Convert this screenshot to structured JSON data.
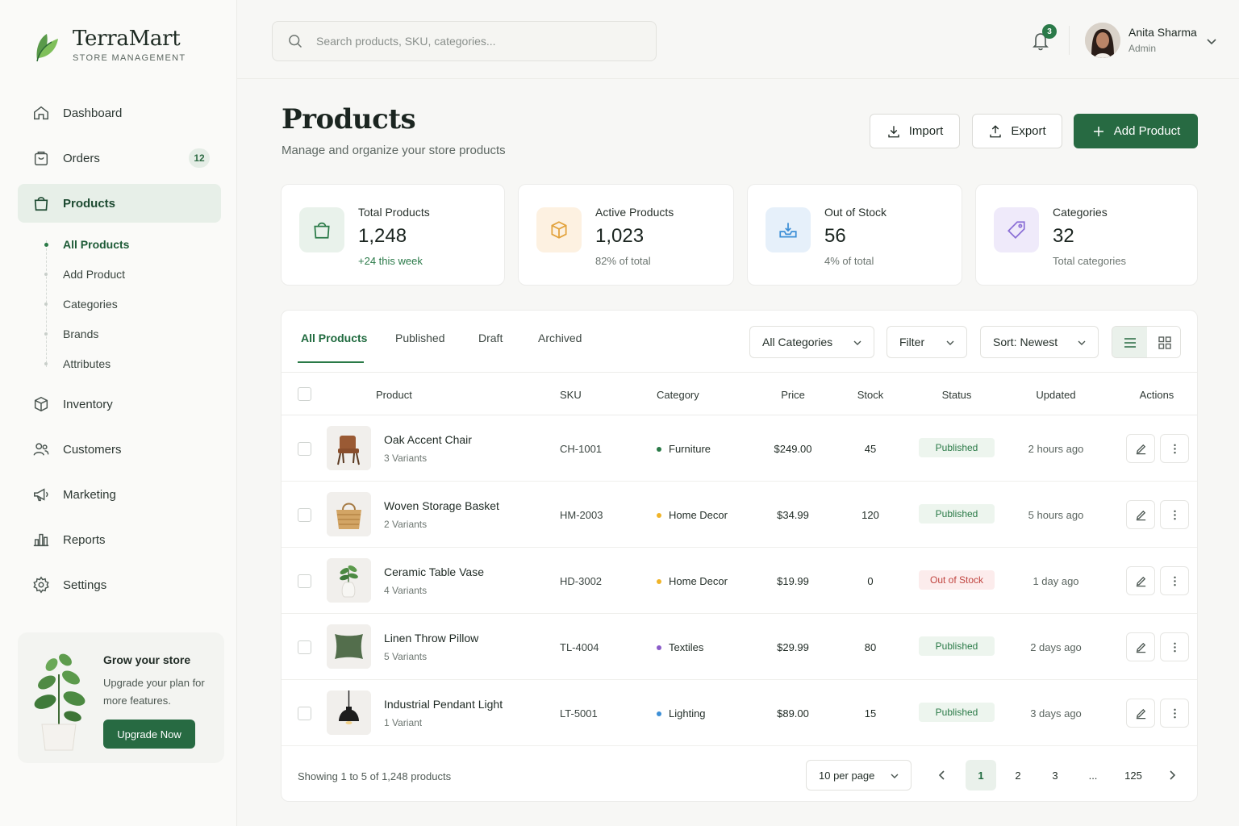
{
  "brand": {
    "name": "TerraMart",
    "subtitle": "STORE MANAGEMENT"
  },
  "sidebar": {
    "items": [
      {
        "label": "Dashboard",
        "icon": "home-icon"
      },
      {
        "label": "Orders",
        "icon": "bag-icon",
        "badge": "12"
      },
      {
        "label": "Products",
        "icon": "shopping-bag-icon",
        "active": true
      },
      {
        "label": "Inventory",
        "icon": "box-icon"
      },
      {
        "label": "Customers",
        "icon": "users-icon"
      },
      {
        "label": "Marketing",
        "icon": "megaphone-icon"
      },
      {
        "label": "Reports",
        "icon": "bar-chart-icon"
      },
      {
        "label": "Settings",
        "icon": "gear-icon"
      }
    ],
    "subitems": [
      {
        "label": "All Products",
        "active": true
      },
      {
        "label": "Add Product"
      },
      {
        "label": "Categories"
      },
      {
        "label": "Brands"
      },
      {
        "label": "Attributes"
      }
    ],
    "promo": {
      "title": "Grow your store",
      "text": "Upgrade your plan for more features.",
      "button": "Upgrade Now"
    }
  },
  "header": {
    "search_placeholder": "Search products, SKU, categories...",
    "notifications": "3",
    "user": {
      "name": "Anita Sharma",
      "role": "Admin"
    }
  },
  "page": {
    "title": "Products",
    "subtitle": "Manage and organize your store products",
    "actions": {
      "import": "Import",
      "export": "Export",
      "add": "Add Product"
    }
  },
  "stats": [
    {
      "label": "Total Products",
      "value": "1,248",
      "note": "+24 this week",
      "icon": "shopping-bag-icon",
      "color": "#e9f2eb"
    },
    {
      "label": "Active Products",
      "value": "1,023",
      "note": "82% of total",
      "icon": "cube-icon",
      "color": "#fdf1e1"
    },
    {
      "label": "Out of Stock",
      "value": "56",
      "note": "4% of total",
      "icon": "empty-box-icon",
      "color": "#e6f0fa"
    },
    {
      "label": "Categories",
      "value": "32",
      "note": "Total categories",
      "icon": "tag-icon",
      "color": "#efeafa"
    }
  ],
  "table": {
    "tabs": [
      "All Products",
      "Published",
      "Draft",
      "Archived"
    ],
    "filters": {
      "category": "All Categories",
      "filter": "Filter",
      "sort": "Sort: Newest"
    },
    "columns": [
      "Product",
      "SKU",
      "Category",
      "Price",
      "Stock",
      "Status",
      "Updated",
      "Actions"
    ],
    "rows": [
      {
        "name": "Oak Accent Chair",
        "variants": "3 Variants",
        "sku": "CH-1001",
        "category": "Furniture",
        "cat_color": "#2a7a47",
        "price": "$249.00",
        "stock": "45",
        "status": "Published",
        "updated": "2 hours ago",
        "thumb": "chair"
      },
      {
        "name": "Woven Storage Basket",
        "variants": "2 Variants",
        "sku": "HM-2003",
        "category": "Home Decor",
        "cat_color": "#f0b429",
        "price": "$34.99",
        "stock": "120",
        "status": "Published",
        "updated": "5 hours ago",
        "thumb": "basket"
      },
      {
        "name": "Ceramic Table Vase",
        "variants": "4 Variants",
        "sku": "HD-3002",
        "category": "Home Decor",
        "cat_color": "#f0b429",
        "price": "$19.99",
        "stock": "0",
        "status": "Out of Stock",
        "updated": "1 day ago",
        "thumb": "vase"
      },
      {
        "name": "Linen Throw Pillow",
        "variants": "5 Variants",
        "sku": "TL-4004",
        "category": "Textiles",
        "cat_color": "#8b5cc9",
        "price": "$29.99",
        "stock": "80",
        "status": "Published",
        "updated": "2 days ago",
        "thumb": "pillow"
      },
      {
        "name": "Industrial Pendant Light",
        "variants": "1 Variant",
        "sku": "LT-5001",
        "category": "Lighting",
        "cat_color": "#3d8fd6",
        "price": "$89.00",
        "stock": "15",
        "status": "Published",
        "updated": "3 days ago",
        "thumb": "lamp"
      }
    ],
    "footer": {
      "showing": "Showing 1 to 5 of 1,248 products",
      "per_page": "10 per page",
      "pages": [
        "1",
        "2",
        "3",
        "...",
        "125"
      ]
    }
  }
}
